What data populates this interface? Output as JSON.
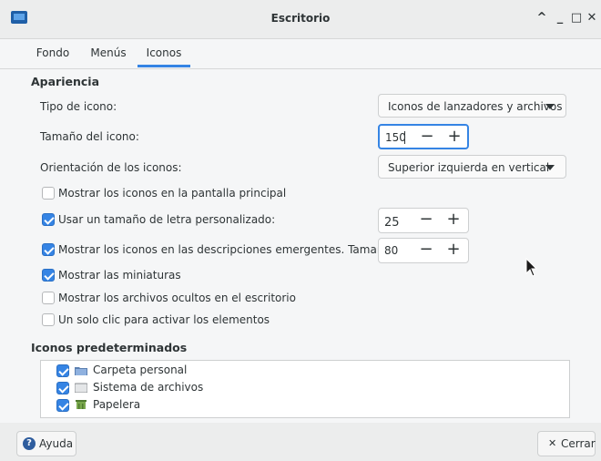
{
  "window": {
    "title": "Escritorio",
    "controls": {
      "up": "^",
      "minimize": "_",
      "maximize": "□",
      "close": "✕"
    }
  },
  "tabs": [
    {
      "label": "Fondo",
      "active": false
    },
    {
      "label": "Menús",
      "active": false
    },
    {
      "label": "Iconos",
      "active": true
    }
  ],
  "appearance": {
    "title": "Apariencia",
    "icon_type": {
      "label": "Tipo de icono:",
      "value": "Iconos de lanzadores y archivos"
    },
    "icon_size": {
      "label": "Tamaño del icono:",
      "value": "150"
    },
    "orientation": {
      "label": "Orientación de los iconos:",
      "value": "Superior izquierda en vertical"
    },
    "options": [
      {
        "label": "Mostrar los iconos en la pantalla principal",
        "checked": false
      },
      {
        "label": "Usar un tamaño de letra personalizado:",
        "checked": true,
        "value": "25"
      },
      {
        "label": "Mostrar los iconos en las descripciones emergentes. Tamaño:",
        "checked": true,
        "value": "80"
      },
      {
        "label": "Mostrar las miniaturas",
        "checked": true
      },
      {
        "label": "Mostrar los archivos ocultos en el escritorio",
        "checked": false
      },
      {
        "label": "Un solo clic para activar los elementos",
        "checked": false
      }
    ]
  },
  "default_icons": {
    "title": "Iconos predeterminados",
    "items": [
      {
        "label": "Carpeta personal",
        "checked": true,
        "icon": "folder-icon"
      },
      {
        "label": "Sistema de archivos",
        "checked": true,
        "icon": "drive-icon"
      },
      {
        "label": "Papelera",
        "checked": true,
        "icon": "trash-icon"
      }
    ]
  },
  "spin_symbols": {
    "minus": "−",
    "plus": "+"
  },
  "buttons": {
    "help": "Ayuda",
    "close": "Cerrar",
    "help_glyph": "?",
    "close_glyph": "✕"
  },
  "colors": {
    "accent": "#3584e4"
  }
}
